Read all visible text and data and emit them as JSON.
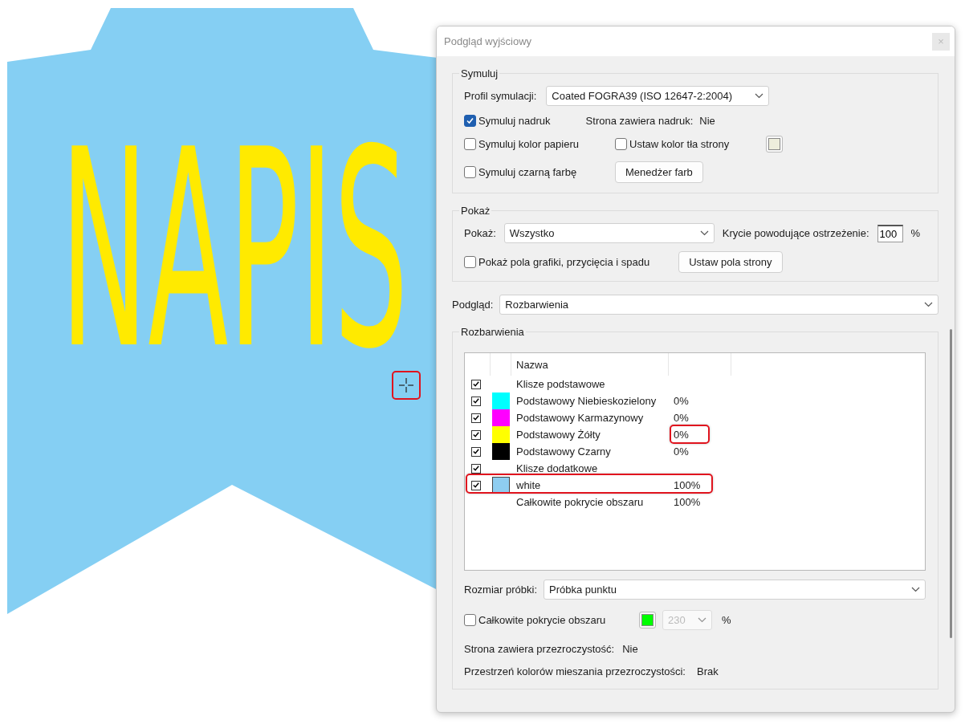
{
  "document": {
    "heading": "NAPIS",
    "cursor_highlighted": true
  },
  "dialog": {
    "title": "Podgląd wyjściowy",
    "close_label": "×",
    "simulate": {
      "legend": "Symuluj",
      "profile_label": "Profil symulacji:",
      "profile_value": "Coated FOGRA39 (ISO 12647-2:2004)",
      "overprint": {
        "label": "Symuluj nadruk",
        "checked": true
      },
      "overprint_info_label": "Strona zawiera nadruk:",
      "overprint_info_value": "Nie",
      "paper": {
        "label": "Symuluj kolor papieru",
        "checked": false
      },
      "page_bg": {
        "label": "Ustaw kolor tła strony",
        "checked": false
      },
      "black_ink": {
        "label": "Symuluj czarną farbę",
        "checked": false
      },
      "ink_manager_button": "Menedżer farb"
    },
    "show": {
      "legend": "Pokaż",
      "show_label": "Pokaż:",
      "show_value": "Wszystko",
      "warning_label": "Krycie powodujące ostrzeżenie:",
      "warning_value": "100",
      "warning_unit": "%",
      "boxes": {
        "label": "Pokaż pola grafiki, przycięcia i spadu",
        "checked": false
      },
      "page_boxes_button": "Ustaw pola strony"
    },
    "preview_label": "Podgląd:",
    "preview_value": "Rozbarwienia",
    "separations": {
      "legend": "Rozbarwienia",
      "columns": [
        "Nazwa"
      ],
      "rows": [
        {
          "kind": "group",
          "name": "Klisze podstawowe",
          "checked": true,
          "value_marked": false,
          "row_marked": false
        },
        {
          "kind": "ink",
          "name": "Podstawowy Niebieskozielony",
          "checked": true,
          "color": "#00ffff",
          "coverage": "0%",
          "value_marked": false,
          "row_marked": false
        },
        {
          "kind": "ink",
          "name": "Podstawowy Karmazynowy",
          "checked": true,
          "color": "#ff00ff",
          "coverage": "0%",
          "value_marked": false,
          "row_marked": false
        },
        {
          "kind": "ink",
          "name": "Podstawowy Żółty",
          "checked": true,
          "color": "#ffff00",
          "coverage": "0%",
          "value_marked": true,
          "row_marked": false
        },
        {
          "kind": "ink",
          "name": "Podstawowy Czarny",
          "checked": true,
          "color": "#000000",
          "coverage": "0%",
          "value_marked": false,
          "row_marked": false
        },
        {
          "kind": "group",
          "name": "Klisze dodatkowe",
          "checked": true,
          "value_marked": false,
          "row_marked": false
        },
        {
          "kind": "ink",
          "name": "white",
          "checked": true,
          "color": "#8ecdf0",
          "coverage": "100%",
          "value_marked": false,
          "row_marked": true
        },
        {
          "kind": "total",
          "name": "Całkowite pokrycie obszaru",
          "coverage": "100%",
          "value_marked": false,
          "row_marked": false
        }
      ]
    },
    "sample_label": "Rozmiar próbki:",
    "sample_value": "Próbka punktu",
    "total_area": {
      "label": "Całkowite pokrycie obszaru",
      "checked": false,
      "value": "230",
      "unit": "%",
      "disabled": true
    },
    "transparency_label": "Strona zawiera przezroczystość:",
    "transparency_value": "Nie",
    "blend_label": "Przestrzeń kolorów mieszania przezroczystości:",
    "blend_value": "Brak"
  }
}
